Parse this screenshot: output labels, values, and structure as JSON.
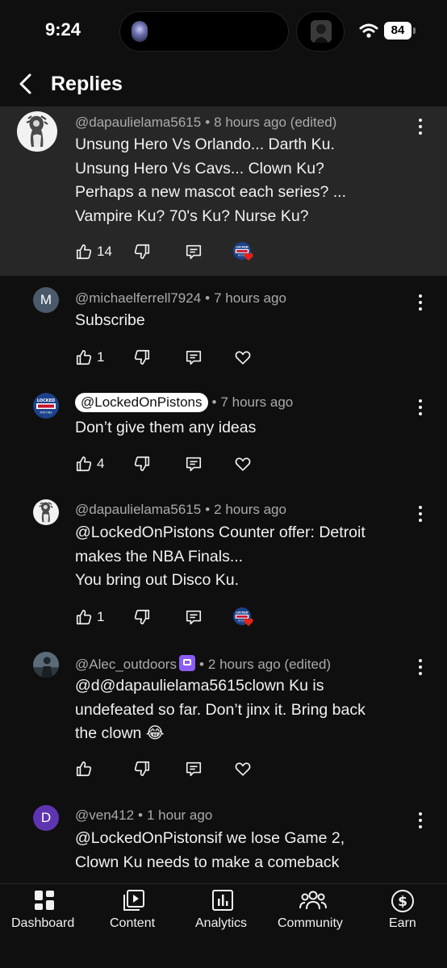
{
  "status_bar": {
    "time": "9:24",
    "battery": "84"
  },
  "header": {
    "title": "Replies"
  },
  "comments": [
    {
      "handle": "@dapaulielama5615",
      "time": "8 hours ago (edited)",
      "lines": [
        "Unsung Hero Vs Orlando... Darth Ku.",
        "Unsung Hero Vs Cavs... Clown Ku?",
        "Perhaps a new mascot each series? ...",
        "Vampire Ku? 70's Ku? Nurse Ku?"
      ],
      "likes": "14"
    },
    {
      "avatar_letter": "M",
      "avatar_color": "#4a5a6a",
      "handle": "@michaelferrell7924",
      "time": "7 hours ago",
      "lines": [
        "Subscribe"
      ],
      "likes": "1"
    },
    {
      "handle": "@LockedOnPistons",
      "time": "7 hours ago",
      "lines": [
        "Don’t give them any ideas"
      ],
      "likes": "4"
    },
    {
      "handle": "@dapaulielama5615",
      "time": "2 hours ago",
      "lines": [
        "@LockedOnPistons Counter offer: Detroit",
        "makes the NBA Finals...",
        "You bring out Disco Ku."
      ],
      "likes": "1"
    },
    {
      "handle": "@Alec_outdoors",
      "time": "2 hours ago (edited)",
      "lines": [
        "@d@dapaulielama5615clown Ku is",
        "undefeated so far. Don’t jinx it. Bring back",
        "the clown 😂"
      ],
      "likes": ""
    },
    {
      "avatar_letter": "D",
      "avatar_color": "#5e35b1",
      "handle": "@ven412",
      "time": "1 hour ago",
      "lines": [
        "@LockedOnPistonsif we lose Game 2,",
        "Clown Ku needs to make a comeback"
      ],
      "likes": ""
    }
  ],
  "mini_logo": "LOCKED ON PISTONS",
  "nav": [
    {
      "label": "Dashboard",
      "icon": "dashboard-icon"
    },
    {
      "label": "Content",
      "icon": "content-icon"
    },
    {
      "label": "Analytics",
      "icon": "analytics-icon"
    },
    {
      "label": "Community",
      "icon": "community-icon"
    },
    {
      "label": "Earn",
      "icon": "earn-icon"
    }
  ],
  "colors": {
    "background": "#0f0f0f",
    "highlight": "#272727",
    "meta": "#aaaaaa",
    "heart": "#e62117",
    "badge": "#8c5cf5"
  }
}
